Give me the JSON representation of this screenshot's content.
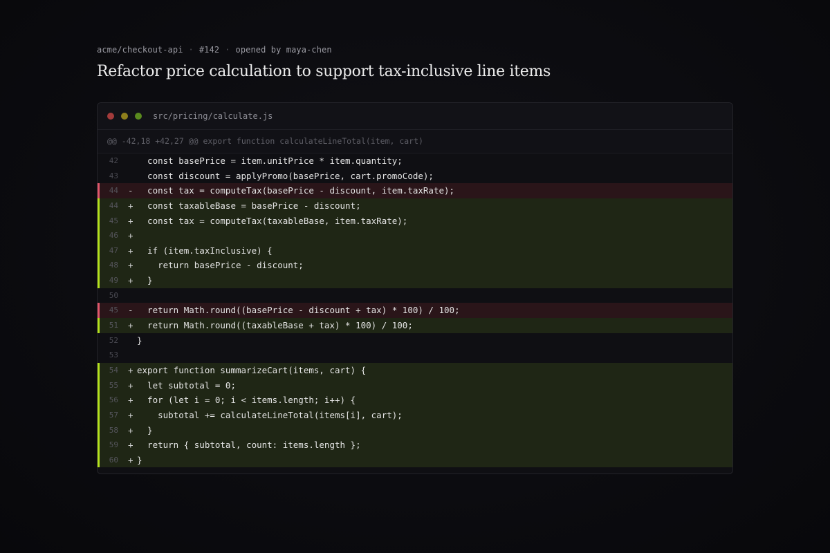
{
  "header": {
    "repo": "acme/checkout-api",
    "pr_number": "#142",
    "opened_by": "opened by maya-chen",
    "separator": "·",
    "title": "Refactor price calculation to support tax-inclusive line items"
  },
  "colors": {
    "deleted_accent": "#e0566a",
    "added_accent": "#b4e21c",
    "deleted_bg": "#2a1519",
    "added_bg": "#1f2615"
  },
  "diff": {
    "filename": "src/pricing/calculate.js",
    "hunk_header": "@@ -42,18 +42,27 @@ export function calculateLineTotal(item, cart)",
    "lines": [
      {
        "num": "42",
        "type": "ctx",
        "sign": " ",
        "code": "  const basePrice = item.unitPrice * item.quantity;"
      },
      {
        "num": "43",
        "type": "ctx",
        "sign": " ",
        "code": "  const discount = applyPromo(basePrice, cart.promoCode);"
      },
      {
        "num": "44",
        "type": "del",
        "sign": "-",
        "code": "  const tax = computeTax(basePrice - discount, item.taxRate);"
      },
      {
        "num": "44",
        "type": "add",
        "sign": "+",
        "code": "  const taxableBase = basePrice - discount;"
      },
      {
        "num": "45",
        "type": "add",
        "sign": "+",
        "code": "  const tax = computeTax(taxableBase, item.taxRate);"
      },
      {
        "num": "46",
        "type": "add",
        "sign": "+",
        "code": ""
      },
      {
        "num": "47",
        "type": "add",
        "sign": "+",
        "code": "  if (item.taxInclusive) {"
      },
      {
        "num": "48",
        "type": "add",
        "sign": "+",
        "code": "    return basePrice - discount;"
      },
      {
        "num": "49",
        "type": "add",
        "sign": "+",
        "code": "  }"
      },
      {
        "num": "50",
        "type": "ctx",
        "sign": " ",
        "code": ""
      },
      {
        "num": "45",
        "type": "del",
        "sign": "-",
        "code": "  return Math.round((basePrice - discount + tax) * 100) / 100;"
      },
      {
        "num": "51",
        "type": "add",
        "sign": "+",
        "code": "  return Math.round((taxableBase + tax) * 100) / 100;"
      },
      {
        "num": "52",
        "type": "ctx",
        "sign": " ",
        "code": "}"
      },
      {
        "num": "53",
        "type": "ctx",
        "sign": " ",
        "code": ""
      },
      {
        "num": "54",
        "type": "add",
        "sign": "+",
        "code": "export function summarizeCart(items, cart) {"
      },
      {
        "num": "55",
        "type": "add",
        "sign": "+",
        "code": "  let subtotal = 0;"
      },
      {
        "num": "56",
        "type": "add",
        "sign": "+",
        "code": "  for (let i = 0; i < items.length; i++) {"
      },
      {
        "num": "57",
        "type": "add",
        "sign": "+",
        "code": "    subtotal += calculateLineTotal(items[i], cart);"
      },
      {
        "num": "58",
        "type": "add",
        "sign": "+",
        "code": "  }"
      },
      {
        "num": "59",
        "type": "add",
        "sign": "+",
        "code": "  return { subtotal, count: items.length };"
      },
      {
        "num": "60",
        "type": "add",
        "sign": "+",
        "code": "}"
      }
    ]
  }
}
